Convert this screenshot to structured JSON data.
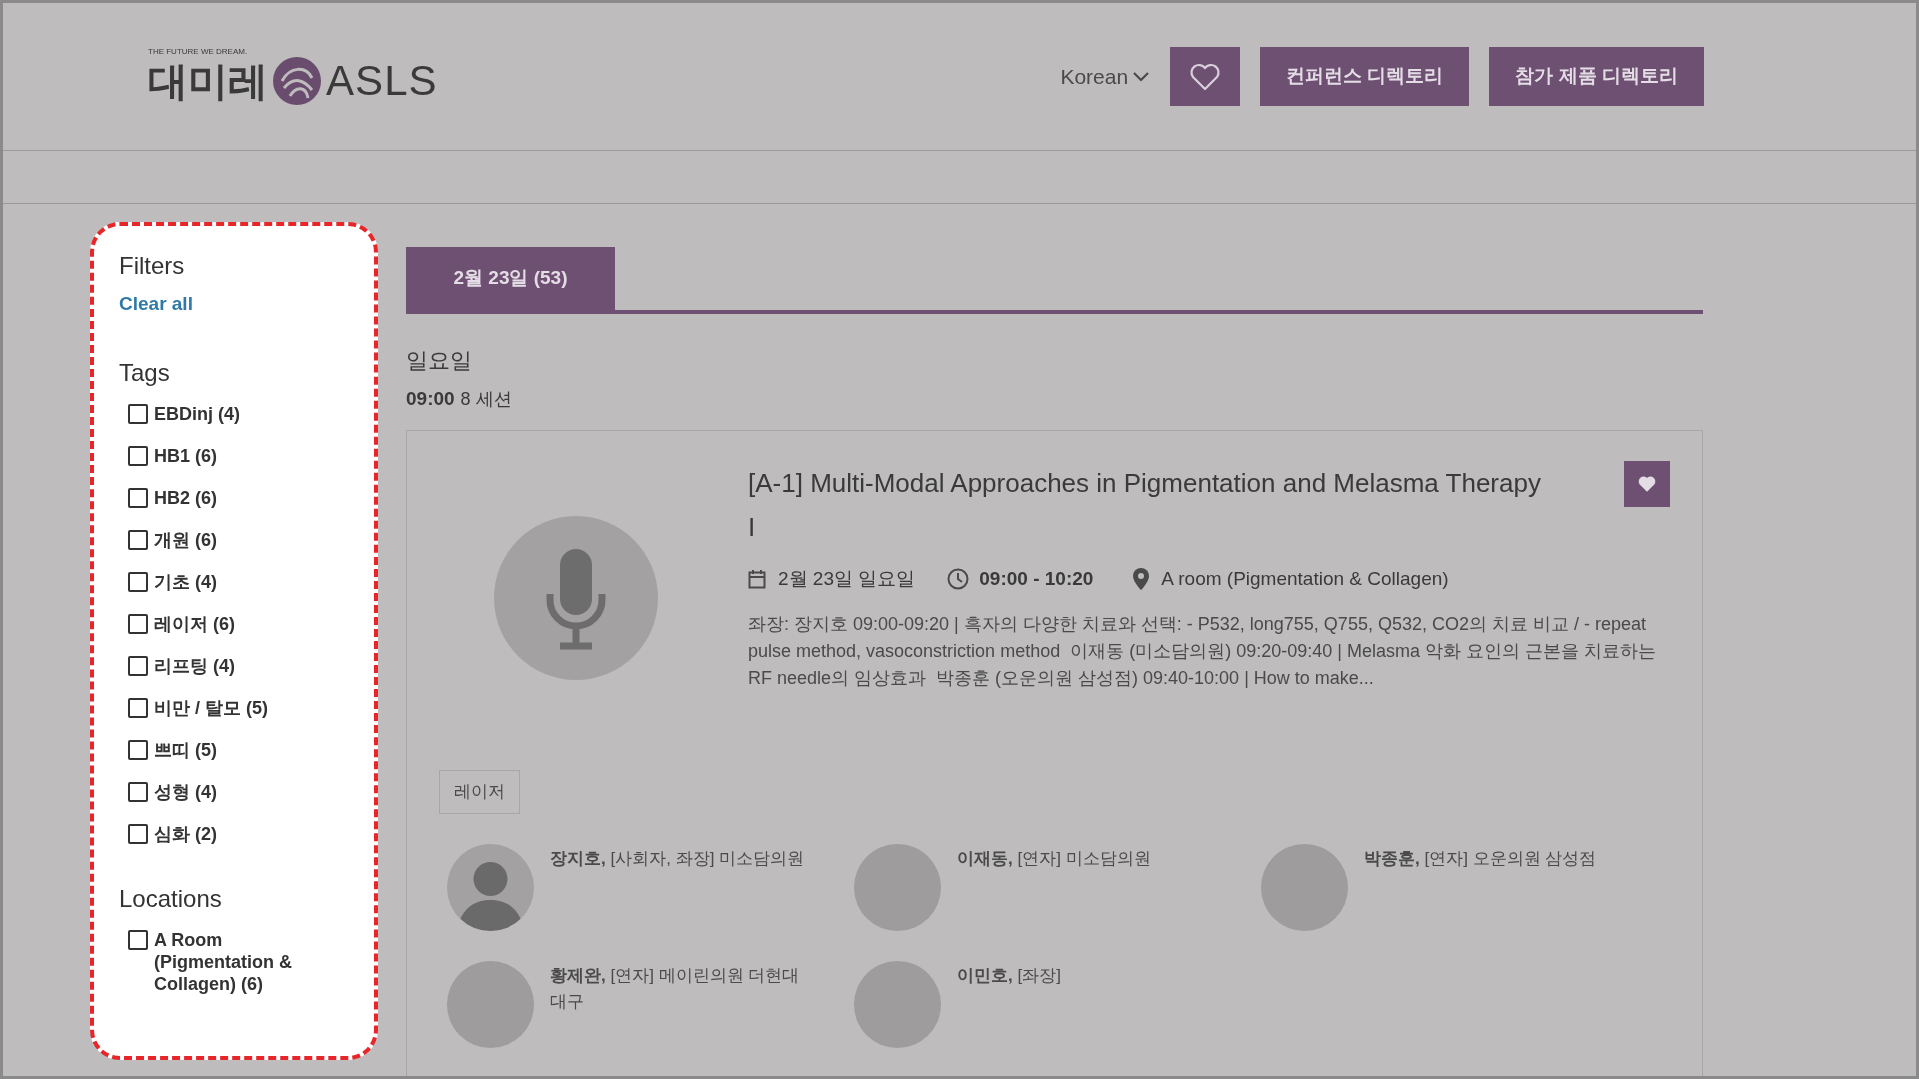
{
  "header": {
    "logo": {
      "tagline": "THE FUTURE WE DREAM.",
      "korean": "대미레",
      "brand": "ASLS"
    },
    "language": "Korean",
    "buttons": [
      "컨퍼런스 디렉토리",
      "참가 제품 디렉토리"
    ]
  },
  "filters": {
    "title": "Filters",
    "clear": "Clear all",
    "groups": [
      {
        "title": "Tags",
        "options": [
          {
            "label": "EBDinj (4)",
            "checked": false
          },
          {
            "label": "HB1 (6)",
            "checked": false
          },
          {
            "label": "HB2 (6)",
            "checked": false
          },
          {
            "label": "개원 (6)",
            "checked": false
          },
          {
            "label": "기초 (4)",
            "checked": false
          },
          {
            "label": "레이저 (6)",
            "checked": false
          },
          {
            "label": "리프팅 (4)",
            "checked": false
          },
          {
            "label": "비만 / 탈모 (5)",
            "checked": false
          },
          {
            "label": "쁘띠 (5)",
            "checked": false
          },
          {
            "label": "성형 (4)",
            "checked": false
          },
          {
            "label": "심화 (2)",
            "checked": false
          }
        ]
      },
      {
        "title": "Locations",
        "options": [
          {
            "label": "A Room (Pigmentation & Collagen) (6)",
            "checked": false
          }
        ]
      }
    ]
  },
  "tabs": [
    {
      "label": "2월 23일 (53)",
      "selected": true
    }
  ],
  "day": "일요일",
  "slot": {
    "time": "09:00",
    "count": "8 세션"
  },
  "session": {
    "title": "[A-1] Multi-Modal Approaches in Pigmentation and Melasma Therapy I",
    "favorite": true,
    "date": "2월 23일 일요일",
    "time": "09:00 - 10:20",
    "room": "A room (Pigmentation & Collagen)",
    "description": "좌장: 장지호 09:00-09:20 | 흑자의 다양한 치료와 선택: - P532, long755, Q755, Q532, CO2의 치료 비교 / - repeat pulse method, vasoconstriction method  이재동 (미소담의원) 09:20-09:40 | Melasma 악화 요인의 근본을 치료하는 RF needle의 임상효과  박종훈 (오운의원 삼성점) 09:40-10:00 | How to make...",
    "tags": [
      "레이저"
    ],
    "speakers": [
      {
        "text": "**장지호,** [사회자, 좌장] 미소담의원",
        "kind": "silhouette"
      },
      {
        "text": "**이재동,** [연자] 미소담의원",
        "kind": "photo"
      },
      {
        "text": "**박종훈,** [연자] 오운의원 삼성점",
        "kind": "photo"
      },
      {
        "text": "**황제완,** [연자] 메이린의원 더현대 대구",
        "kind": "photo"
      },
      {
        "text": "**이민호,** [좌장]",
        "kind": "photo"
      }
    ]
  }
}
